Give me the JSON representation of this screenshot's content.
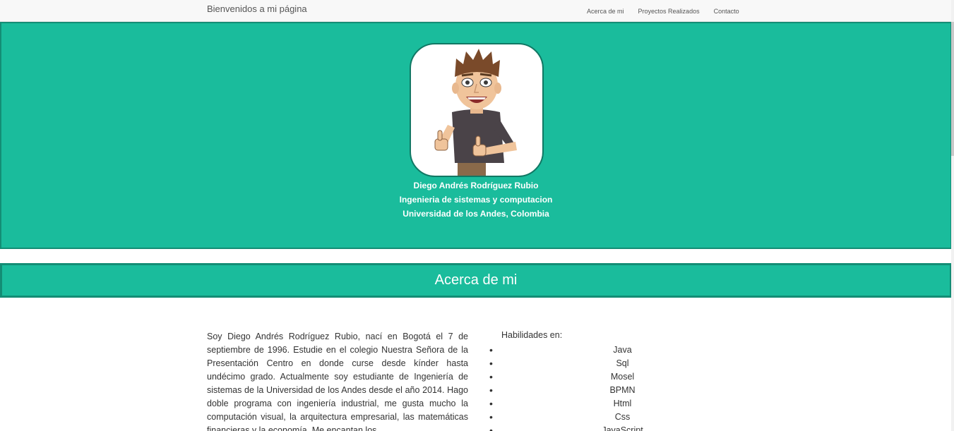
{
  "navbar": {
    "brand": "Bienvenidos a mi página",
    "links": [
      "Acerca de mi",
      "Proyectos Realizados",
      "Contacto"
    ]
  },
  "hero": {
    "name": "Diego Andrés Rodríguez Rubio",
    "career": "Ingenieria de sistemas y computacion",
    "university": "Universidad de los Andes, Colombia"
  },
  "about": {
    "section_title": "Acerca de mi",
    "paragraph": "Soy Diego Andrés Rodríguez Rubio, nací en Bogotá el 7 de septiembre de 1996. Estudie en el colegio Nuestra Señora de la Presentación Centro en donde curse desde kínder hasta undécimo grado. Actualmente soy estudiante de Ingeniería de sistemas de la Universidad de los Andes desde el año 2014. Hago doble programa con ingeniería industrial, me gusta mucho la computación visual, la arquitectura empresarial, las matemáticas financieras y la economía. Me encantan los",
    "skills_title": "Habilidades en:",
    "skills": [
      "Java",
      "Sql",
      "Mosel",
      "BPMN",
      "Html",
      "Css",
      "JavaScript"
    ]
  },
  "colors": {
    "accent": "#1abc9c",
    "accent_border": "#138d75",
    "navbar_bg": "#f8f8f8"
  }
}
